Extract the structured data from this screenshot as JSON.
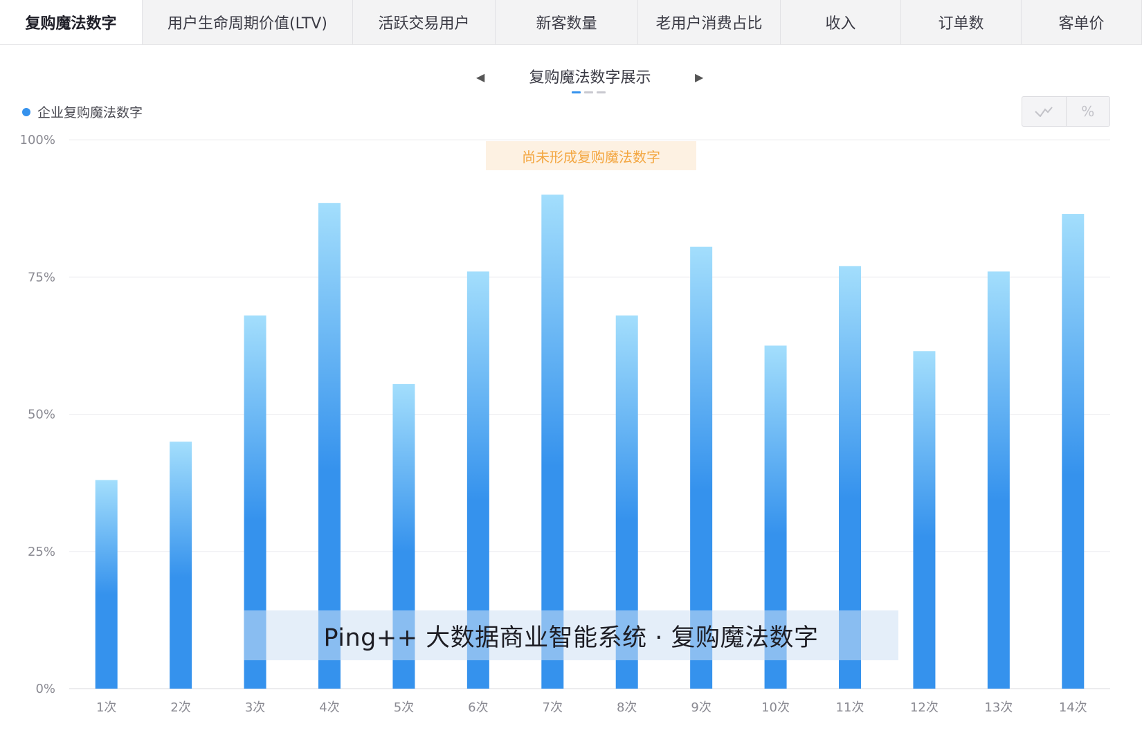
{
  "tabs": [
    {
      "label": "复购魔法数字",
      "active": true
    },
    {
      "label": "用户生命周期价值(LTV)",
      "active": false
    },
    {
      "label": "活跃交易用户",
      "active": false
    },
    {
      "label": "新客数量",
      "active": false
    },
    {
      "label": "老用户消费占比",
      "active": false
    },
    {
      "label": "收入",
      "active": false
    },
    {
      "label": "订单数",
      "active": false
    },
    {
      "label": "客单价",
      "active": false
    }
  ],
  "carousel": {
    "title": "复购魔法数字展示",
    "pages": 3,
    "current": 1
  },
  "toggle": {
    "line_icon": "line-chart-icon",
    "percent_label": "%"
  },
  "badge_text": "尚未形成复购魔法数字",
  "watermark_text": "Ping++ 大数据商业智能系统 · 复购魔法数字",
  "colors": {
    "bar_top": "#a3defc",
    "bar_bottom": "#3592ed",
    "badge_text": "#f3a640",
    "badge_bg": "#fdf1e2"
  },
  "chart_data": {
    "type": "bar",
    "categories": [
      "1次",
      "2次",
      "3次",
      "4次",
      "5次",
      "6次",
      "7次",
      "8次",
      "9次",
      "10次",
      "11次",
      "12次",
      "13次",
      "14次"
    ],
    "series": [
      {
        "name": "企业复购魔法数字",
        "values": [
          38,
          45,
          68,
          88.5,
          55.5,
          76,
          90,
          68,
          80.5,
          62.5,
          77,
          61.5,
          76,
          86.5
        ]
      }
    ],
    "ylim": [
      0,
      100
    ],
    "yticks": [
      0,
      25,
      50,
      75,
      100
    ],
    "ytick_labels": [
      "0%",
      "25%",
      "50%",
      "75%",
      "100%"
    ],
    "grid": true,
    "legend": "top-left"
  }
}
